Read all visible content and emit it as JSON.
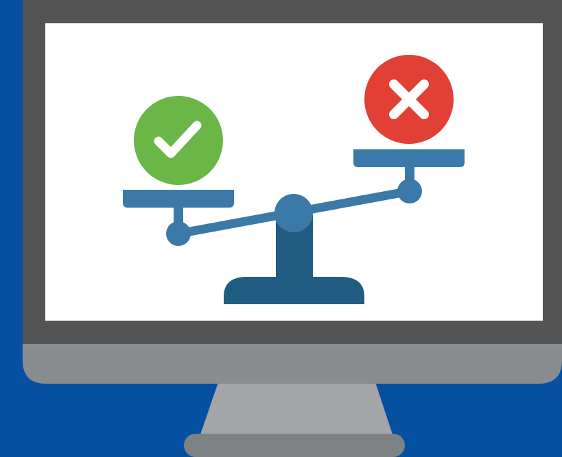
{
  "colors": {
    "background": "#0550a0",
    "monitor_bezel": "#545454",
    "monitor_chin": "#8a8d8f",
    "monitor_stand": "#a3a5a6",
    "monitor_base": "#7f8284",
    "screen": "#ffffff",
    "scale_beam": "#3b7aa8",
    "scale_pillar": "#215c82",
    "check_circle": "#6ab647",
    "cross_circle": "#e23f35",
    "mark": "#ffffff"
  },
  "icons": {
    "approve": "check-mark-icon",
    "reject": "cross-mark-icon",
    "balance": "balance-scale-icon",
    "device": "desktop-monitor-icon"
  }
}
